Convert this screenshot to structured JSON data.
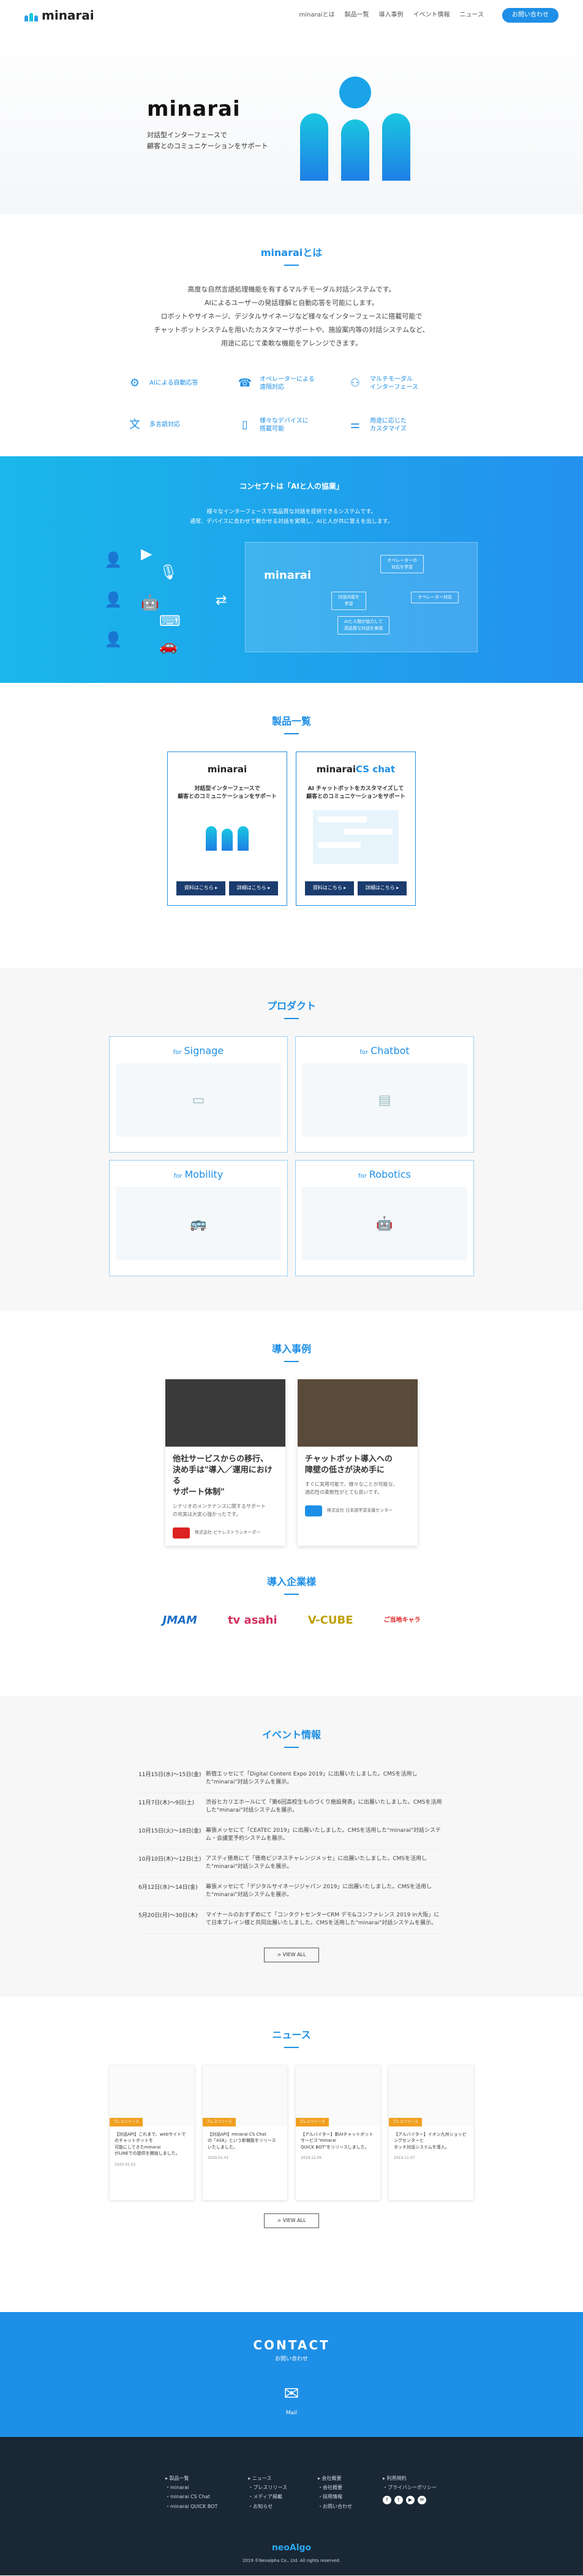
{
  "header": {
    "logo": "minarai",
    "nav": [
      "minaraiとは",
      "製品一覧",
      "導入事例",
      "イベント情報",
      "ニュース"
    ],
    "cta": "お問い合わせ"
  },
  "hero": {
    "title": "minarai",
    "subtitle": "対話型インターフェースで\n顧客とのコミュニケーションをサポート"
  },
  "about": {
    "title": "minaraiとは",
    "text": "高度な自然言語処理機能を有するマルチモーダル対話システムです。\nAIによるユーザーの発話理解と自動応答を可能にします。\nロボットやサイネージ、デジタルサイネージなど様々なインターフェースに搭載可能で\nチャットボットシステムを用いたカスタマーサポートや、施設案内等の対話システムなど、\n用途に応じて柔軟な機能をアレンジできます。",
    "features": [
      {
        "icon": "ai-icon",
        "label": "AIによる自動応答"
      },
      {
        "icon": "operator-icon",
        "label": "オペレーターによる\n遠隔対応"
      },
      {
        "icon": "multimodal-icon",
        "label": "マルチモーダル\nインターフェース"
      },
      {
        "icon": "translate-icon",
        "label": "多言語対応"
      },
      {
        "icon": "device-icon",
        "label": "様々なデバイスに\n搭載可能"
      },
      {
        "icon": "custom-icon",
        "label": "用途に応じた\nカスタマイズ"
      }
    ]
  },
  "concept": {
    "title": "コンセプトは「AIと人の協業」",
    "text": "様々なインターフェースで高品質な対話を提供できるシステムです。\n通常、デバイスに合わせて動かせる対話を実現し、AIと人が共に答えを出します。",
    "center": "minarai",
    "pills": [
      "オペレーターの\n対応を学習",
      "対話内容を\n学習",
      "AIと人間が協力して\n高品質な対話を実現",
      "オペレーター対応"
    ]
  },
  "products": {
    "title": "製品一覧",
    "items": [
      {
        "logo": "minarai",
        "tag": "対話型インターフェースで\n顧客とのコミュニケーションをサポート",
        "btn1": "資料はこちら ▸",
        "btn2": "詳細はこちら ▸"
      },
      {
        "logo": "minarai",
        "logo_suffix": "CS chat",
        "tag": "AI チャットボットをカスタマイズして\n顧客とのコミュニケーションをサポート",
        "btn1": "資料はこちら ▸",
        "btn2": "詳細はこちら ▸"
      }
    ]
  },
  "projects": {
    "title": "プロダクト",
    "items": [
      {
        "for": "for",
        "name": "Signage"
      },
      {
        "for": "for",
        "name": "Chatbot"
      },
      {
        "for": "for",
        "name": "Mobility"
      },
      {
        "for": "for",
        "name": "Robotics"
      }
    ]
  },
  "cases": {
    "title": "導入事例",
    "items": [
      {
        "title": "他社サービスからの移行、\n決め手は\"導入／運用における\nサポート体制\"",
        "text": "シナリオのメンテナンスに関するサポート\nの充実は大変心強かったです。",
        "company": "株式会社 ビヤレストランオーダー"
      },
      {
        "title": "チャットボット導入への\n障壁の低さが決め手に",
        "text": "すぐに実用可能で、様々なことが可能な、\n適応性の柔軟性がとても良いです。",
        "company": "株式会社 日本語学習支援センター"
      }
    ]
  },
  "clients": {
    "title": "導入企業様",
    "items": [
      "JMAM",
      "tv asahi",
      "V-CUBE",
      "ご当地キャラ"
    ]
  },
  "events": {
    "title": "イベント情報",
    "items": [
      {
        "date": "11月15日(水)〜15日(金)",
        "text": "新宿エッセにて「Digital Content Expo 2019」に出展いたしました。CMSを活用した\"minarai\"対話システムを展示。"
      },
      {
        "date": "11月7日(木)〜9日(土)",
        "text": "渋谷ヒカリエホールにて「第6回高校生ものづくり施設発表」に出展いたしました。CMSを活用した\"minarai\"対話システムを展示。"
      },
      {
        "date": "10月15日(火)〜18日(金)",
        "text": "幕張メッセにて「CEATEC 2019」に出展いたしました。CMSを活用した\"minarai\"対話システム・会議室予約システムを展示。"
      },
      {
        "date": "10月10日(木)〜12日(土)",
        "text": "アスティ徳島にて「徳島ビジネスチャレンジメッセ」に出展いたしました。CMSを活用した\"minarai\"対話システムを展示。"
      },
      {
        "date": "6月12日(水)〜14日(金)",
        "text": "幕張メッセにて「デジタルサイネージジャパン 2019」に出展いたしました。CMSを活用した\"minarai\"対話システムを展示。"
      },
      {
        "date": "5月20日(月)〜30日(木)",
        "text": "マイナールのおすずめにて「コンタクトセンターCRM デモ&コンファレンス 2019 in大阪」にて日本ブレイン様と共同出展いたしました。CMSを活用した\"minarai\"対話システムを展示。"
      }
    ],
    "view_all": "> VIEW ALL"
  },
  "news": {
    "title": "ニュース",
    "items": [
      {
        "tag": "プレスリリース",
        "text": "【対話API】これまで、webサイトでのチャットボットを\n可能にしてきたminarai\nがLINEでの提供を開始しました。",
        "date": "2020.02.02"
      },
      {
        "tag": "プレスリリース",
        "text": "【対話API】minarai CS Chat\nの「ASK」という新機能をリリース\nいたしました。",
        "date": "2020.01.01"
      },
      {
        "tag": "プレスリリース",
        "text": "【アルバイター】新AIチャットボットサービス\"minarai\nQUICK BOT\"をリリースしました。",
        "date": "2019.12.05"
      },
      {
        "tag": "プレスリリース",
        "text": "【アルバイター】イオン九州ショッピングセンターと\nタッチ対話システムを導入。",
        "date": "2019.11.07"
      }
    ],
    "view_all": "> VIEW ALL"
  },
  "contact": {
    "title": "CONTACT",
    "subtitle": "お問い合わせ",
    "mail": "Mail"
  },
  "footer": {
    "col1": [
      "▸ 製品一覧",
      "・minarai",
      "・minarai CS Chat",
      "・minarai QUICK BOT"
    ],
    "col2": [
      "▸ ニュース",
      "・プレスリリース",
      "・メディア掲載",
      "・お知らせ"
    ],
    "col3": [
      "▸ 会社概要",
      "・会社概要",
      "・採用情報",
      "・お問い合わせ"
    ],
    "col4": [
      "▸ 利用規約",
      "・プライバシーポリシー"
    ],
    "logo": "neoAlgo",
    "copyright": "2019 ©Neoalpha Co., Ltd. All rights reserved."
  }
}
